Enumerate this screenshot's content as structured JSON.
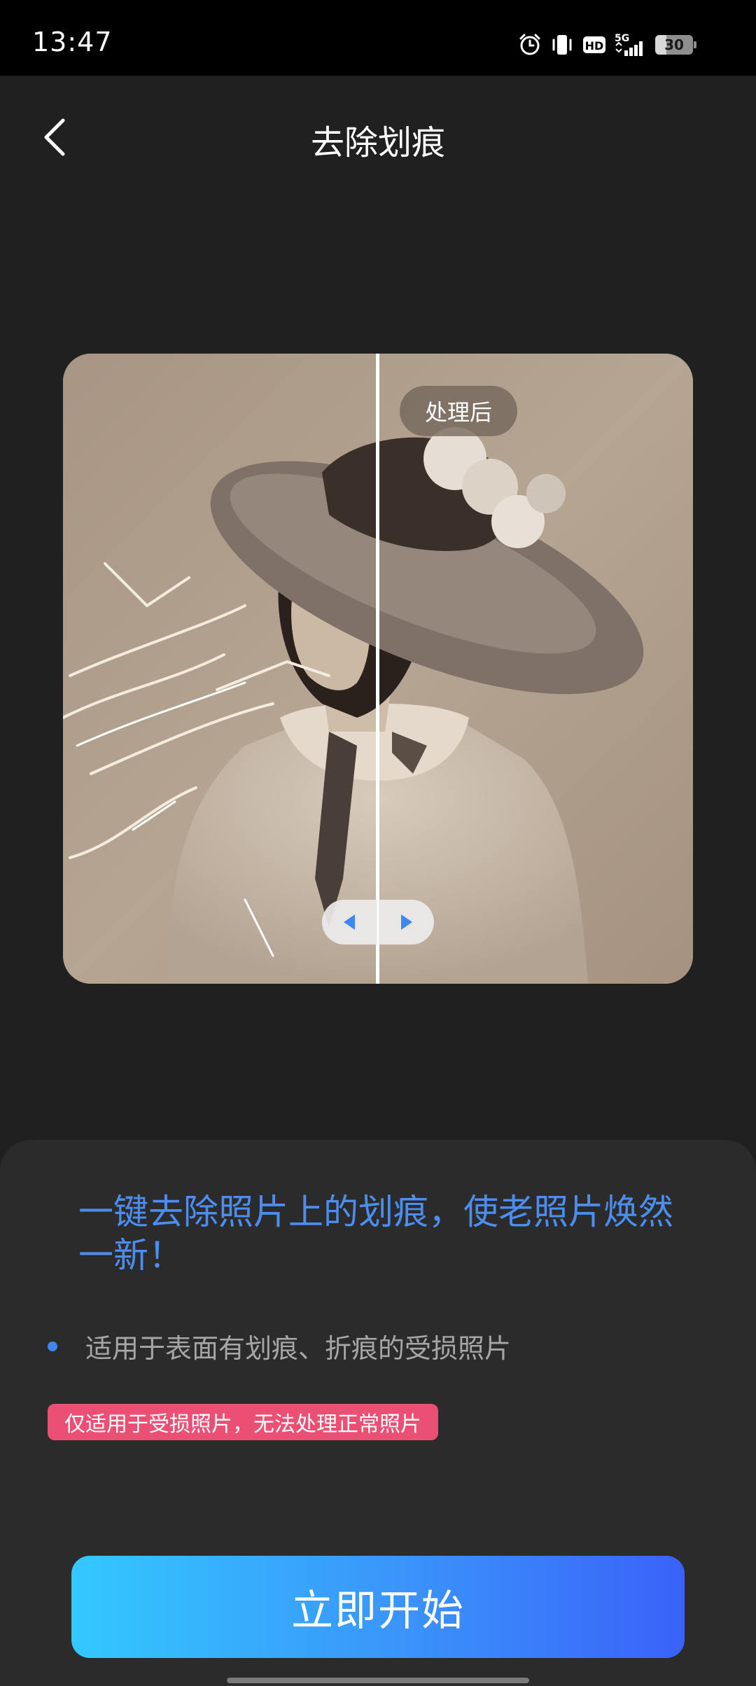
{
  "status_bar": {
    "time": "13:47",
    "network": "5G",
    "hd_label": "HD",
    "battery": "30",
    "icons": [
      "alarm-icon",
      "vibrate-icon",
      "hd-icon",
      "signal-icon",
      "battery-icon"
    ]
  },
  "header": {
    "back_icon": "chevron-left-icon",
    "title": "去除划痕"
  },
  "preview": {
    "after_label": "处理后",
    "handle_left_icon": "arrow-left-icon",
    "handle_right_icon": "arrow-right-icon"
  },
  "info": {
    "headline": "一键去除照片上的划痕，使老照片焕然一新！",
    "bullets": [
      "适用于表面有划痕、折痕的受损照片"
    ],
    "warning": "仅适用于受损照片，无法处理正常照片"
  },
  "actions": {
    "start_label": "立即开始"
  },
  "colors": {
    "background": "#202020",
    "panel": "#2b2b2b",
    "accent_blue": "#4b8df0",
    "warning_pink": "#ec4f74",
    "button_gradient_start": "#33c8fe",
    "button_gradient_end": "#3a62f9"
  }
}
